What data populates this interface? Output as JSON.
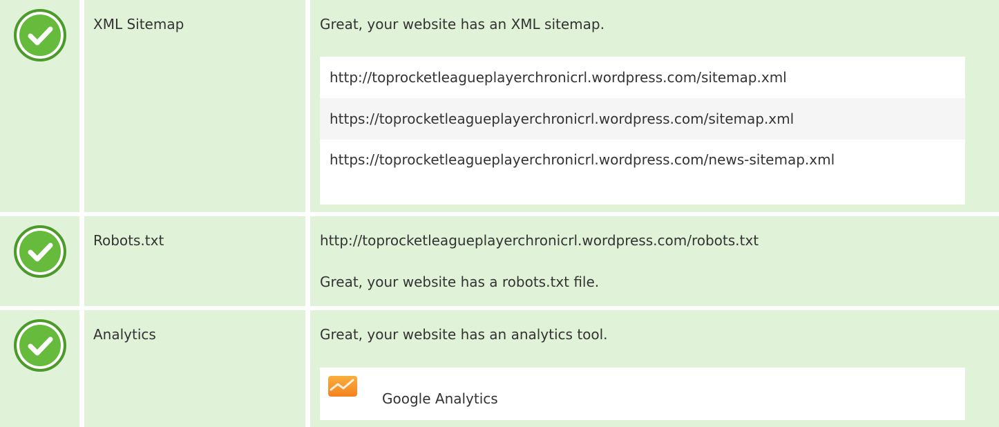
{
  "colors": {
    "row_background": "#e0f2d8",
    "check_green": "#66bb3d",
    "analytics_orange": "#f58220"
  },
  "rows": [
    {
      "icon": "check-circle-icon",
      "label": "XML Sitemap",
      "message": "Great, your website has an XML sitemap.",
      "sitemaps": [
        "http://toprocketleagueplayerchronicrl.wordpress.com/sitemap.xml",
        "https://toprocketleagueplayerchronicrl.wordpress.com/sitemap.xml",
        "https://toprocketleagueplayerchronicrl.wordpress.com/news-sitemap.xml"
      ]
    },
    {
      "icon": "check-circle-icon",
      "label": "Robots.txt",
      "url": "http://toprocketleagueplayerchronicrl.wordpress.com/robots.txt",
      "message": "Great, your website has a robots.txt file."
    },
    {
      "icon": "check-circle-icon",
      "label": "Analytics",
      "message": "Great, your website has an analytics tool.",
      "tools": [
        {
          "icon": "google-analytics-icon",
          "name": "Google Analytics"
        }
      ]
    }
  ]
}
